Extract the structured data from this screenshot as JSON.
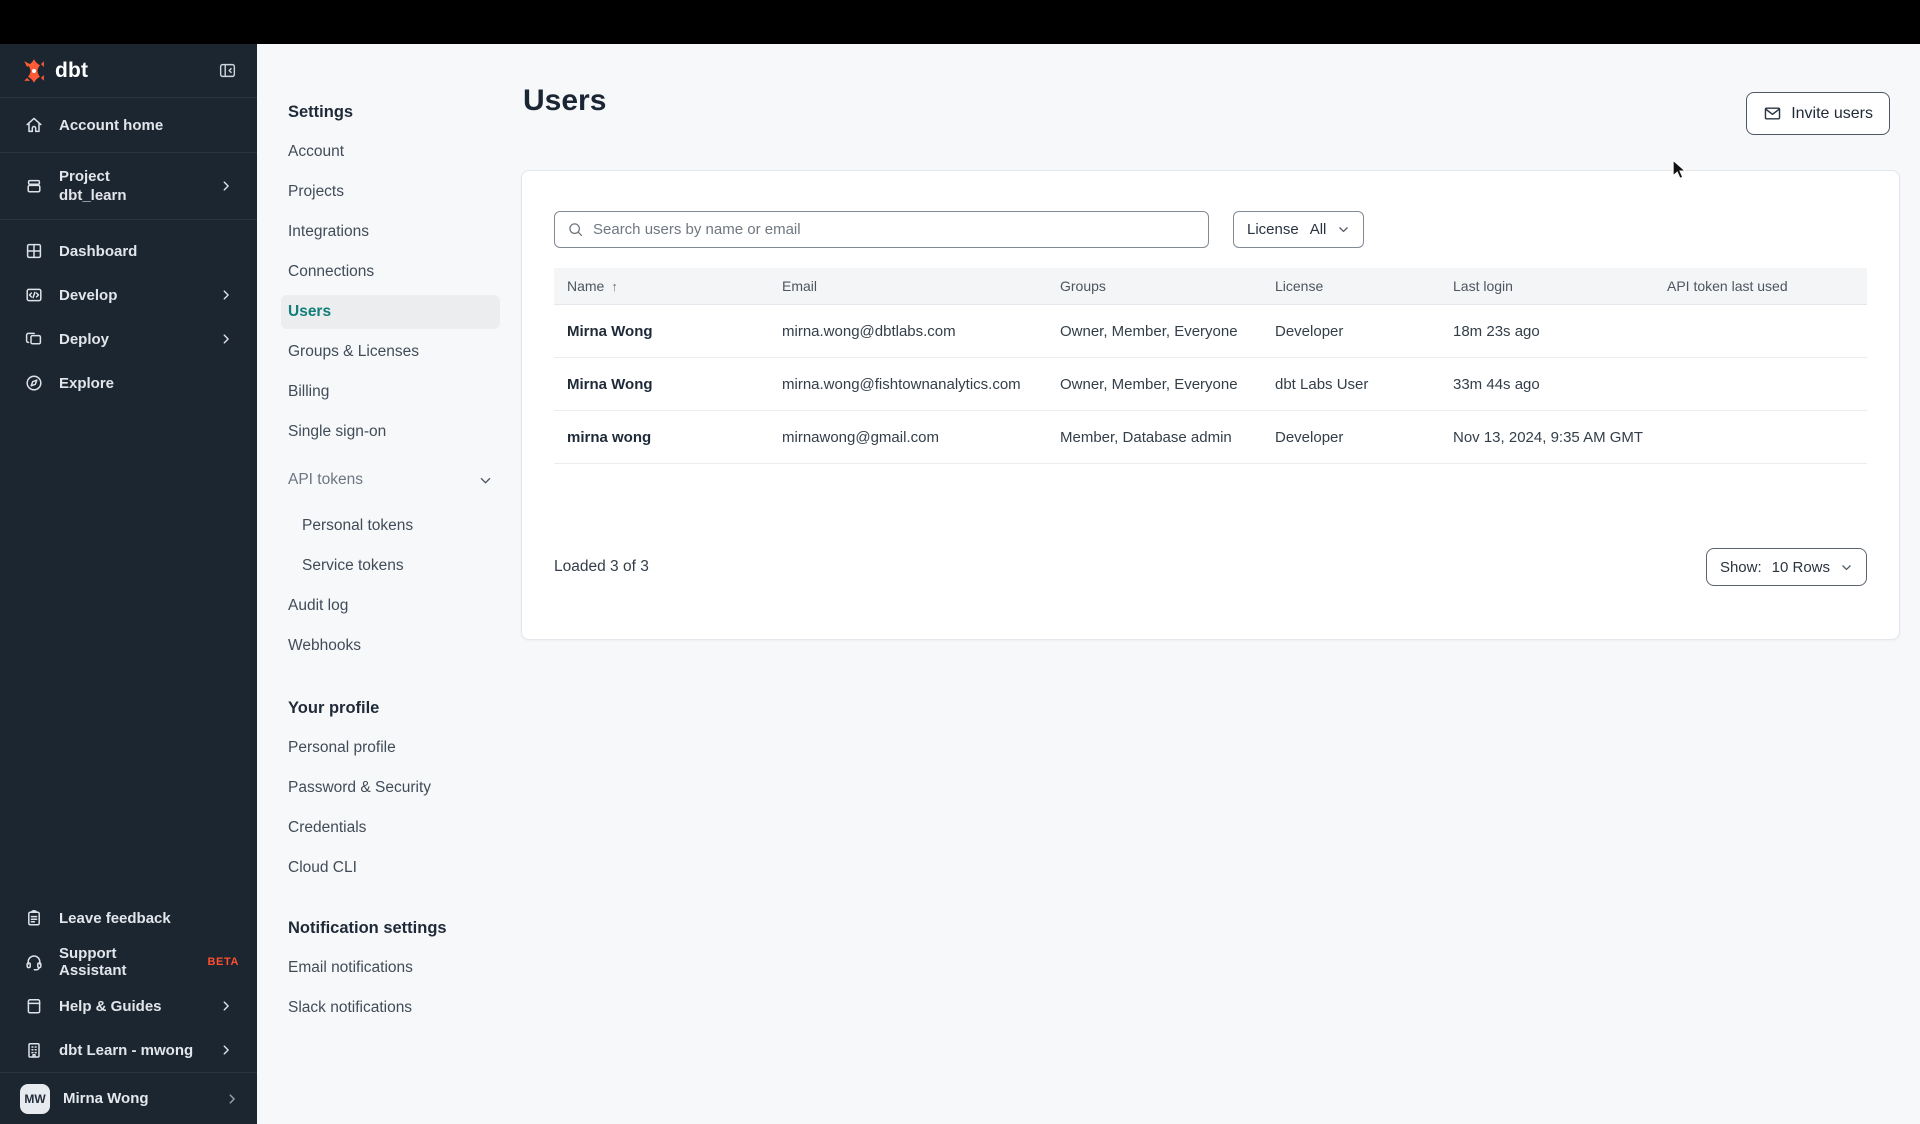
{
  "colors": {
    "brand_orange": "#ff5c35",
    "accent_teal": "#137e77",
    "sidebar_bg": "#1c2631"
  },
  "sidebar": {
    "logo_text": "dbt",
    "primary": [
      {
        "label": "Account home"
      },
      {
        "label": "Project",
        "sublabel": "dbt_learn"
      },
      {
        "label": "Dashboard"
      },
      {
        "label": "Develop"
      },
      {
        "label": "Deploy"
      },
      {
        "label": "Explore"
      }
    ],
    "secondary": [
      {
        "label": "Leave feedback"
      },
      {
        "label": "Support Assistant",
        "badge": "BETA"
      },
      {
        "label": "Help & Guides"
      },
      {
        "label": "dbt Learn - mwong"
      }
    ],
    "user": {
      "initials": "MW",
      "name": "Mirna Wong"
    }
  },
  "settings_nav": {
    "heading": "Settings",
    "items": [
      "Account",
      "Projects",
      "Integrations",
      "Connections",
      "Users",
      "Groups & Licenses",
      "Billing",
      "Single sign-on",
      "API tokens",
      "Personal tokens",
      "Service tokens",
      "Audit log",
      "Webhooks"
    ],
    "active_item": "Users",
    "profile_heading": "Your profile",
    "profile_items": [
      "Personal profile",
      "Password & Security",
      "Credentials",
      "Cloud CLI"
    ],
    "notifications_heading": "Notification settings",
    "notification_items": [
      "Email notifications",
      "Slack notifications"
    ]
  },
  "page": {
    "title": "Users",
    "invite_button": "Invite users"
  },
  "toolbar": {
    "search_placeholder": "Search users by name or email",
    "license_label": "License",
    "license_value": "All"
  },
  "table": {
    "headers": [
      "Name",
      "Email",
      "Groups",
      "License",
      "Last login",
      "API token last used"
    ],
    "sort_column": "Name",
    "sort_indicator": "↑",
    "rows": [
      {
        "name": "Mirna Wong",
        "email": "mirna.wong@dbtlabs.com",
        "groups": "Owner, Member, Everyone",
        "license": "Developer",
        "last_login": "18m 23s ago",
        "api_token_last_used": ""
      },
      {
        "name": "Mirna Wong",
        "email": "mirna.wong@fishtownanalytics.com",
        "groups": "Owner, Member, Everyone",
        "license": "dbt Labs User",
        "last_login": "33m 44s ago",
        "api_token_last_used": ""
      },
      {
        "name": "mirna wong",
        "email": "mirnawong@gmail.com",
        "groups": "Member, Database admin",
        "license": "Developer",
        "last_login": "Nov 13, 2024, 9:35 AM GMT",
        "api_token_last_used": ""
      }
    ]
  },
  "footer": {
    "loaded_text": "Loaded 3 of 3",
    "show_label": "Show:",
    "show_value": "10 Rows"
  }
}
